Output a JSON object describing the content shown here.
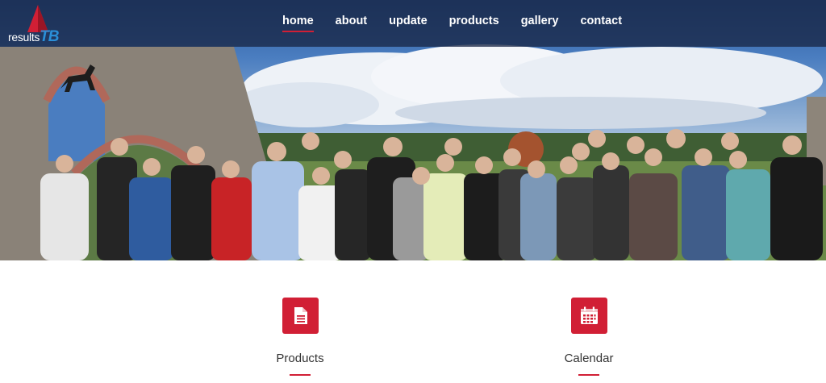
{
  "logo": {
    "part1": "results",
    "part2": "TB"
  },
  "nav": {
    "items": [
      {
        "label": "home",
        "active": true
      },
      {
        "label": "about"
      },
      {
        "label": "update"
      },
      {
        "label": "products"
      },
      {
        "label": "gallery"
      },
      {
        "label": "contact"
      }
    ]
  },
  "features": [
    {
      "label": "Products",
      "icon": "document-icon"
    },
    {
      "label": "Calendar",
      "icon": "calendar-icon"
    }
  ],
  "colors": {
    "accent": "#d11f35",
    "topbar": "#182646",
    "logo_tb": "#2a8fd8"
  }
}
